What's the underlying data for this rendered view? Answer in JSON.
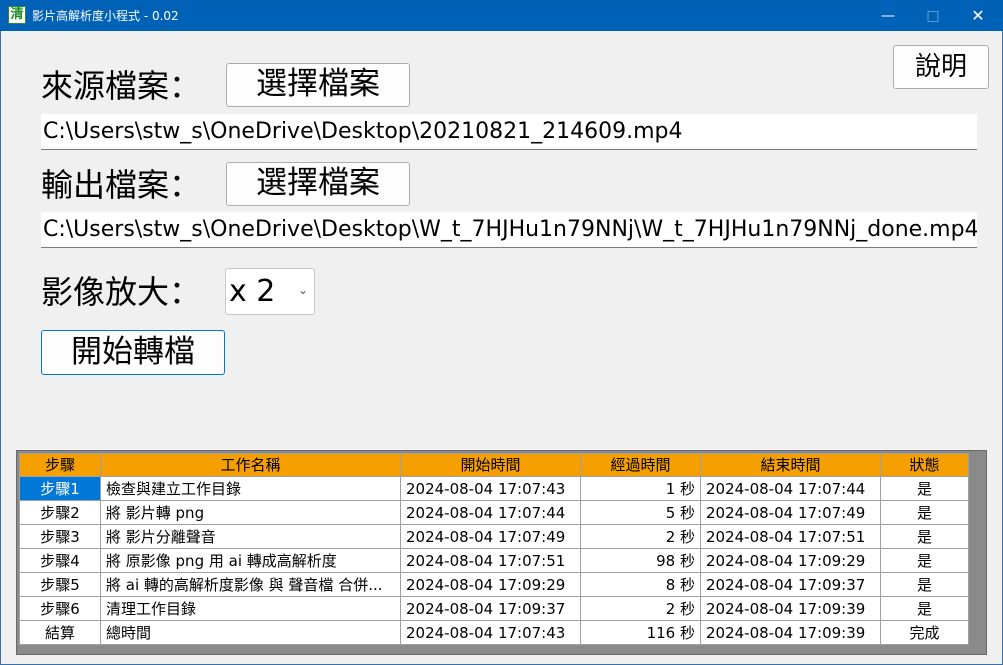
{
  "window": {
    "title": "影片高解析度小程式 - 0.02",
    "icon_char": "清"
  },
  "help_button": "說明",
  "source": {
    "label": "來源檔案：",
    "button": "選擇檔案",
    "path": "C:\\Users\\stw_s\\OneDrive\\Desktop\\20210821_214609.mp4"
  },
  "output": {
    "label": "輸出檔案：",
    "button": "選擇檔案",
    "path": "C:\\Users\\stw_s\\OneDrive\\Desktop\\W_t_7HJHu1n79NNj\\W_t_7HJHu1n79NNj_done.mp4"
  },
  "scale": {
    "label": "影像放大：",
    "selected": "x 2"
  },
  "start_button": "開始轉檔",
  "table": {
    "headers": [
      "步驟",
      "工作名稱",
      "開始時間",
      "經過時間",
      "結束時間",
      "狀態"
    ],
    "rows": [
      {
        "step": "步驟1",
        "name": "檢查與建立工作目錄",
        "start": "2024-08-04 17:07:43",
        "elapsed": "1 秒",
        "end": "2024-08-04 17:07:44",
        "status": "是"
      },
      {
        "step": "步驟2",
        "name": "將 影片轉 png",
        "start": "2024-08-04 17:07:44",
        "elapsed": "5 秒",
        "end": "2024-08-04 17:07:49",
        "status": "是"
      },
      {
        "step": "步驟3",
        "name": "將 影片分離聲音",
        "start": "2024-08-04 17:07:49",
        "elapsed": "2 秒",
        "end": "2024-08-04 17:07:51",
        "status": "是"
      },
      {
        "step": "步驟4",
        "name": "將 原影像 png 用 ai 轉成高解析度",
        "start": "2024-08-04 17:07:51",
        "elapsed": "98 秒",
        "end": "2024-08-04 17:09:29",
        "status": "是"
      },
      {
        "step": "步驟5",
        "name": "將 ai 轉的高解析度影像 與 聲音檔 合併...",
        "start": "2024-08-04 17:09:29",
        "elapsed": "8 秒",
        "end": "2024-08-04 17:09:37",
        "status": "是"
      },
      {
        "step": "步驟6",
        "name": "清理工作目錄",
        "start": "2024-08-04 17:09:37",
        "elapsed": "2 秒",
        "end": "2024-08-04 17:09:39",
        "status": "是"
      },
      {
        "step": "結算",
        "name": "總時間",
        "start": "2024-08-04 17:07:43",
        "elapsed": "116 秒",
        "end": "2024-08-04 17:09:39",
        "status": "完成"
      }
    ]
  },
  "colors": {
    "titlebar": "#0062b6",
    "header": "#f5a000",
    "selection": "#0078d7"
  }
}
